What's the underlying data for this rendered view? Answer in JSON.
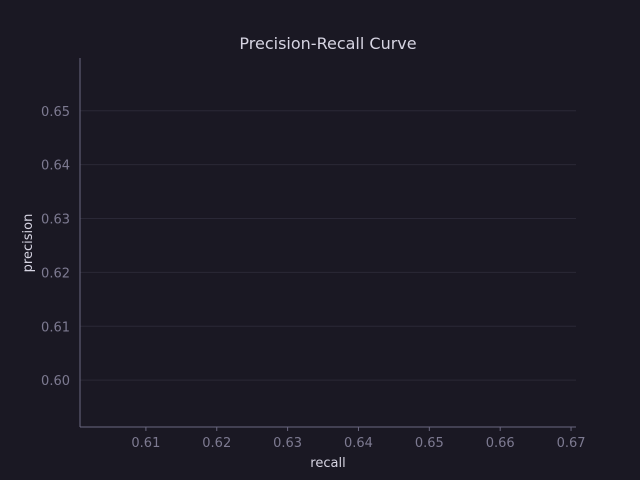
{
  "chart_data": {
    "type": "line",
    "title": "Precision-Recall Curve",
    "xlabel": "recall",
    "ylabel": "precision",
    "xlim": [
      0.6007,
      0.6707
    ],
    "ylim": [
      0.5913,
      0.6598
    ],
    "x_ticks": [
      0.61,
      0.62,
      0.63,
      0.64,
      0.65,
      0.66,
      0.67
    ],
    "x_tick_labels": [
      "0.61",
      "0.62",
      "0.63",
      "0.64",
      "0.65",
      "0.66",
      "0.67"
    ],
    "y_ticks": [
      0.6,
      0.61,
      0.62,
      0.63,
      0.64,
      0.65
    ],
    "y_tick_labels": [
      "0.60",
      "0.61",
      "0.62",
      "0.63",
      "0.64",
      "0.65"
    ],
    "grid": "horizontal",
    "series": [],
    "colors": {
      "background": "#1a1823",
      "text": "#d6d4e2",
      "tick": "#7d7a91",
      "grid": "#2a2836",
      "axis": "#6b6880"
    }
  }
}
